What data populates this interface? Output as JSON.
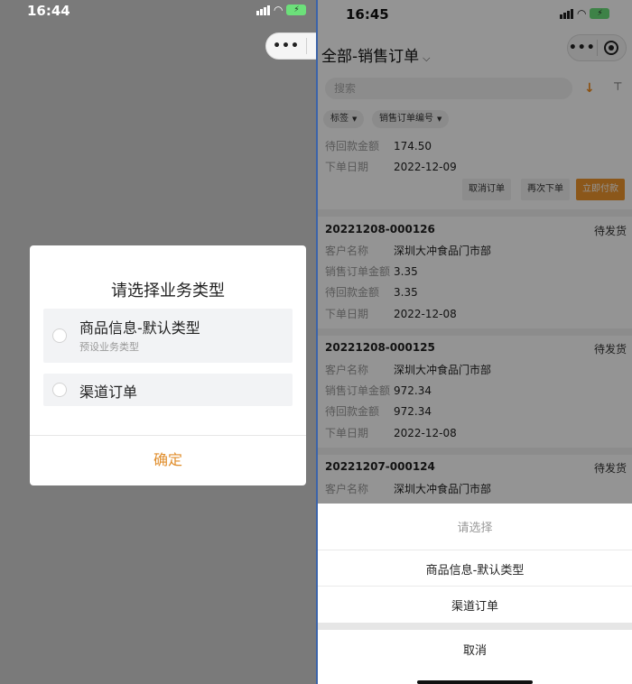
{
  "left": {
    "status": {
      "time": "16:44",
      "battery": "⚡"
    },
    "capsule": {
      "more": "•••"
    },
    "dialog": {
      "title": "请选择业务类型",
      "options": [
        {
          "label": "商品信息-默认类型",
          "sub": "预设业务类型",
          "selected": false
        },
        {
          "label": "渠道订单",
          "sub": "",
          "selected": false
        }
      ],
      "confirm": "确定"
    }
  },
  "right": {
    "status": {
      "time": "16:45",
      "battery": "⚡"
    },
    "nav": {
      "title": "全部-销售订单",
      "chevron": "⌵"
    },
    "capsule": {
      "more": "•••"
    },
    "search": {
      "placeholder": "搜索",
      "sort_icon": "↓",
      "filter_icon": "⊤"
    },
    "chips": [
      {
        "label": "标签",
        "caret": "▼"
      },
      {
        "label": "销售订单编号",
        "caret": "▼"
      }
    ],
    "partial_order": {
      "rows": [
        {
          "k": "待回款金额",
          "v": "174.50"
        },
        {
          "k": "下单日期",
          "v": "2022-12-09"
        }
      ],
      "buttons": [
        "取消订单",
        "再次下单",
        "立即付款"
      ]
    },
    "orders": [
      {
        "no": "20221208-000126",
        "status": "待发货",
        "rows": [
          {
            "k": "客户名称",
            "v": "深圳大冲食品门市部"
          },
          {
            "k": "销售订单金额",
            "v": "3.35"
          },
          {
            "k": "待回款金额",
            "v": "3.35"
          },
          {
            "k": "下单日期",
            "v": "2022-12-08"
          }
        ]
      },
      {
        "no": "20221208-000125",
        "status": "待发货",
        "rows": [
          {
            "k": "客户名称",
            "v": "深圳大冲食品门市部"
          },
          {
            "k": "销售订单金额",
            "v": "972.34"
          },
          {
            "k": "待回款金额",
            "v": "972.34"
          },
          {
            "k": "下单日期",
            "v": "2022-12-08"
          }
        ]
      },
      {
        "no": "20221207-000124",
        "status": "待发货",
        "rows": [
          {
            "k": "客户名称",
            "v": "深圳大冲食品门市部"
          }
        ]
      }
    ],
    "sheet": {
      "hint": "请选择",
      "options": [
        "商品信息-默认类型",
        "渠道订单"
      ],
      "cancel": "取消"
    }
  }
}
